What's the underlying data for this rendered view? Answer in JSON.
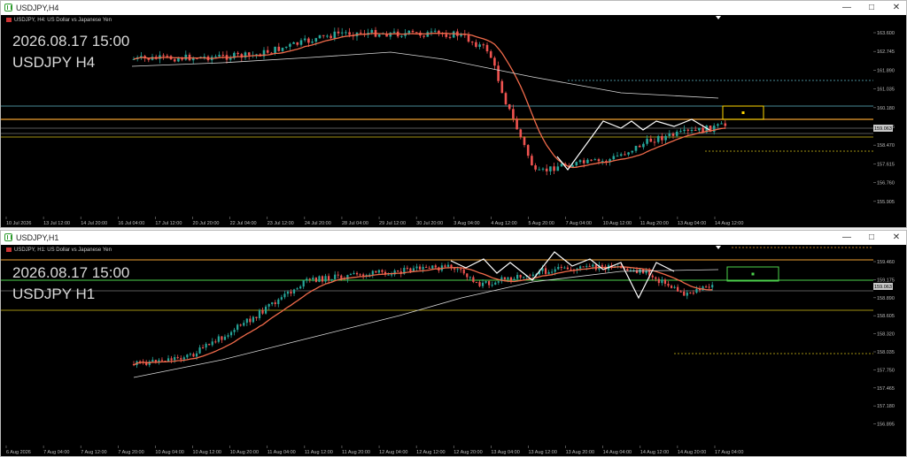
{
  "windows": [
    {
      "title": "USDJPY,H4",
      "header": "USDJPY, H4: US Dollar vs Japanese Yen",
      "overlay_time": "2026.08.17 15:00",
      "overlay_symbol": "USDJPY H4",
      "price_labels": [
        "163.600",
        "162.745",
        "161.890",
        "161.035",
        "160.180",
        "159.325",
        "158.470",
        "157.615",
        "156.760",
        "155.905"
      ],
      "current_price": "159.063",
      "time_labels": [
        "10 Jul 2026",
        "13 Jul 12:00",
        "14 Jul 20:00",
        "16 Jul 04:00",
        "17 Jul 12:00",
        "20 Jul 20:00",
        "22 Jul 04:00",
        "23 Jul 12:00",
        "24 Jul 20:00",
        "28 Jul 04:00",
        "29 Jul 12:00",
        "30 Jul 20:00",
        "3 Aug 04:00",
        "4 Aug 12:00",
        "5 Aug 20:00",
        "7 Aug 04:00",
        "10 Aug 12:00",
        "11 Aug 20:00",
        "13 Aug 04:00",
        "14 Aug 12:00"
      ]
    },
    {
      "title": "USDJPY,H1",
      "header": "USDJPY, H1: US Dollar vs Japanese Yen",
      "overlay_time": "2026.08.17 15:00",
      "overlay_symbol": "USDJPY H1",
      "price_labels": [
        "159.460",
        "159.175",
        "158.890",
        "158.605",
        "158.320",
        "158.035",
        "157.750",
        "157.465",
        "157.180",
        "156.895"
      ],
      "current_price": "159.063",
      "time_labels": [
        "6 Aug 2026",
        "7 Aug 04:00",
        "7 Aug 12:00",
        "7 Aug 20:00",
        "10 Aug 04:00",
        "10 Aug 12:00",
        "10 Aug 20:00",
        "11 Aug 04:00",
        "11 Aug 12:00",
        "11 Aug 20:00",
        "12 Aug 04:00",
        "12 Aug 12:00",
        "12 Aug 20:00",
        "13 Aug 04:00",
        "13 Aug 12:00",
        "13 Aug 20:00",
        "14 Aug 04:00",
        "14 Aug 12:00",
        "14 Aug 20:00",
        "17 Aug 04:00"
      ]
    }
  ],
  "window_controls": [
    "minimize",
    "maximize",
    "close"
  ],
  "colors": {
    "bull": "#26a69a",
    "bear": "#ef5350",
    "ma_fast": "#f06a4a",
    "ma_slow": "#d9d9d9",
    "zigzag": "#ffffff",
    "level_orange": "#f0a030",
    "level_cyan": "#5fb8c8",
    "level_gray": "#b0b0b0",
    "level_yellow": "#d4c018",
    "box_yellow": "#ffd700",
    "box_green": "#4cd24c"
  }
}
